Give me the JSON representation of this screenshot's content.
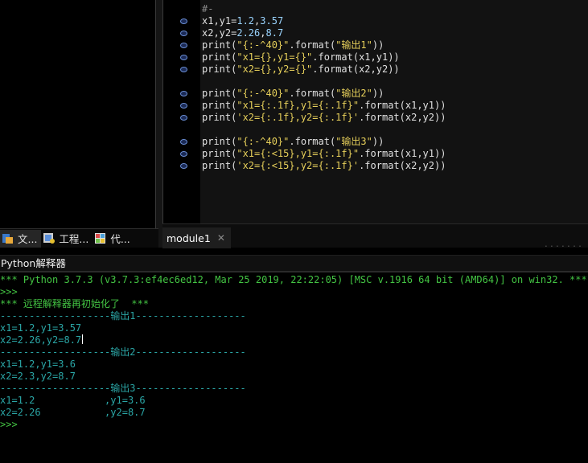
{
  "left_tabs": [
    {
      "label": "文...",
      "icon": "file-icon"
    },
    {
      "label": "工程...",
      "icon": "project-icon"
    },
    {
      "label": "代...",
      "icon": "code-icon"
    }
  ],
  "editor": {
    "tab_label": "module1",
    "close_glyph": "✕",
    "lines": [
      {
        "text": "#-"
      },
      {
        "text": "x1,y1=1.2,3.57"
      },
      {
        "text": "x2,y2=2.26,8.7"
      },
      {
        "text": "print(\"{:-^40}\".format(\"输出1\"))"
      },
      {
        "text": "print(\"x1={},y1={}\".format(x1,y1))"
      },
      {
        "text": "print(\"x2={},y2={}\".format(x2,y2))"
      },
      {
        "text": ""
      },
      {
        "text": "print(\"{:-^40}\".format(\"输出2\"))"
      },
      {
        "text": "print(\"x1={:.1f},y1={:.1f}\".format(x1,y1))"
      },
      {
        "text": "print('x2={:.1f},y2={:.1f}'.format(x2,y2))"
      },
      {
        "text": ""
      },
      {
        "text": "print(\"{:-^40}\".format(\"输出3\"))"
      },
      {
        "text": "print(\"x1={:<15},y1={:.1f}\".format(x1,y1))"
      },
      {
        "text": "print('x2={:<15},y2={:.1f}'.format(x2,y2))"
      }
    ]
  },
  "interpreter": {
    "title": "Python解释器",
    "lines": [
      {
        "text": "*** Python 3.7.3 (v3.7.3:ef4ec6ed12, Mar 25 2019, 22:22:05) [MSC v.1916 64 bit (AMD64)] on win32. ***",
        "color": "green"
      },
      {
        "text": ">>>",
        "color": "green"
      },
      {
        "text": "*** 远程解释器再初始化了  ***",
        "color": "green"
      },
      {
        "text": "-------------------输出1-------------------",
        "color": "teal"
      },
      {
        "text": "x1=1.2,y1=3.57",
        "color": "teal"
      },
      {
        "text": "x2=2.26,y2=8.7",
        "color": "teal"
      },
      {
        "text": "-------------------输出2-------------------",
        "color": "teal"
      },
      {
        "text": "x1=1.2,y1=3.6",
        "color": "teal"
      },
      {
        "text": "x2=2.3,y2=8.7",
        "color": "teal"
      },
      {
        "text": "-------------------输出3-------------------",
        "color": "teal"
      },
      {
        "text": "x1=1.2            ,y1=3.6",
        "color": "teal"
      },
      {
        "text": "x2=2.26           ,y2=8.7",
        "color": "teal"
      },
      {
        "text": ">>>",
        "color": "green"
      }
    ]
  },
  "colors": {
    "prompt_green": "#43c443",
    "output_teal": "#2aa5a5",
    "string_yellow": "#e6cf5a",
    "number_blue": "#9ad4ff",
    "marker_blue": "#6b8fd6"
  }
}
